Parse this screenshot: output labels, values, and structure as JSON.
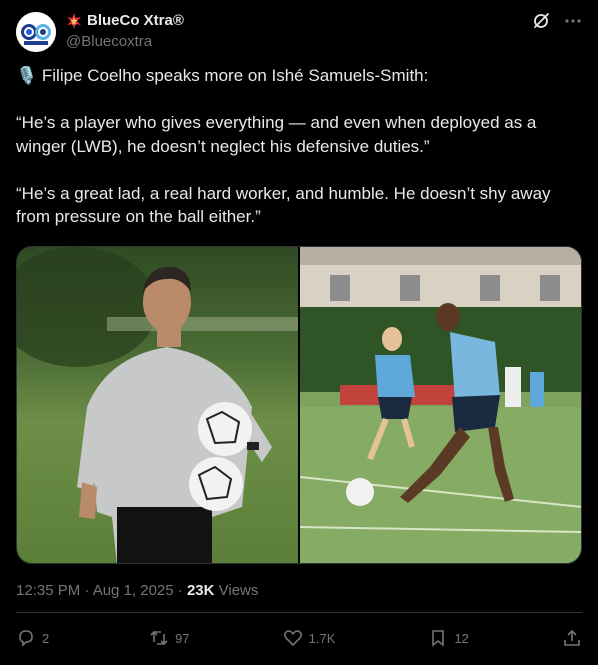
{
  "author": {
    "display_name": "BlueCo Xtra®",
    "handle": "@Bluecoxtra",
    "badge_icon": "collision-emoji-icon"
  },
  "tweet": {
    "line1": "🎙️ Filipe Coelho speaks more on Ishé Samuels-Smith:",
    "quote1": "“He’s a player who gives everything — and even when deployed as a winger (LWB), he doesn’t neglect his defensive duties.”",
    "quote2": "“He’s a great lad, a real hard worker, and humble. He doesn’t shy away from pressure on the ball either.”"
  },
  "meta": {
    "time_date": "12:35 PM · Aug 1, 2025 · ",
    "views_count": "23K",
    "views_label": " Views"
  },
  "stats": {
    "replies": "2",
    "reposts": "97",
    "likes": "1.7K",
    "bookmarks": "12"
  },
  "colors": {
    "background": "#000000",
    "text": "#e7e9ea",
    "muted": "#71767b",
    "border": "#2f3336",
    "brand_blue": "#1e3f8f"
  }
}
